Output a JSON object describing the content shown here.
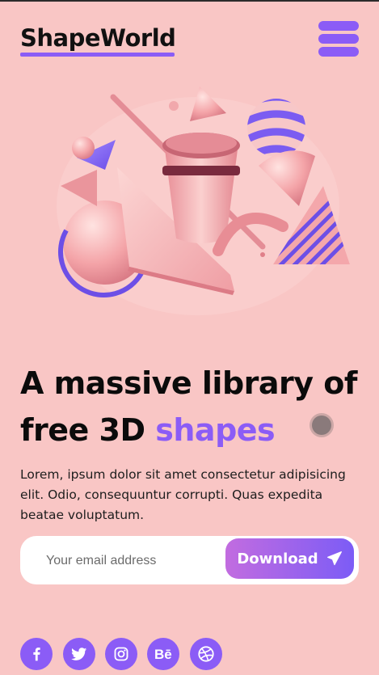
{
  "header": {
    "logo": "ShapeWorld",
    "menu_icon": "hamburger-menu-icon"
  },
  "hero": {
    "image": "3d-shapes-illustration",
    "headline_main": "A massive library of free 3D ",
    "headline_accent": "shapes",
    "description": "Lorem, ipsum dolor sit amet consectetur adipisicing elit. Odio, consequuntur corrupti. Quas expedita beatae voluptatum."
  },
  "form": {
    "email_placeholder": "Your email address",
    "email_value": "",
    "button_label": "Download",
    "button_icon": "paper-plane-icon"
  },
  "social": [
    "facebook-icon",
    "twitter-icon",
    "instagram-icon",
    "behance-icon",
    "dribbble-icon"
  ],
  "colors": {
    "background": "#f9c6c5",
    "accent": "#8b5cf6",
    "button_gradient_start": "#c26ce0",
    "button_gradient_end": "#7c5cf6",
    "text": "#0b0b0b"
  }
}
